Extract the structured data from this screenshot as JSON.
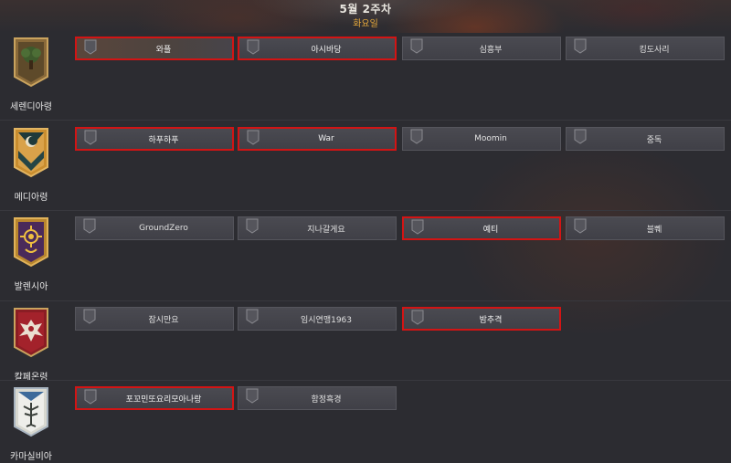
{
  "header": {
    "title": "5월 2주차",
    "subtitle": "화요일"
  },
  "colors": {
    "selected_border": "#d31414",
    "subtitle": "#e6a93b",
    "slot_bg": "#45454c",
    "page_bg": "#2c2c31"
  },
  "territories": [
    {
      "name": "세렌디아령",
      "crest_icon": "tree-crest-icon",
      "guilds": [
        {
          "label": "와플",
          "selected": true
        },
        {
          "label": "아시바당",
          "selected": true
        },
        {
          "label": "심흥부",
          "selected": false
        },
        {
          "label": "킹도사리",
          "selected": false
        }
      ]
    },
    {
      "name": "메디아령",
      "crest_icon": "crescent-crest-icon",
      "guilds": [
        {
          "label": "하푸하푸",
          "selected": true
        },
        {
          "label": "War",
          "selected": true
        },
        {
          "label": "Moomin",
          "selected": false
        },
        {
          "label": "중독",
          "selected": false
        }
      ]
    },
    {
      "name": "발렌시아",
      "crest_icon": "sun-crest-icon",
      "guilds": [
        {
          "label": "GroundZero",
          "selected": false
        },
        {
          "label": "지나갈게요",
          "selected": false
        },
        {
          "label": "예티",
          "selected": true
        },
        {
          "label": "블쀄",
          "selected": false
        }
      ]
    },
    {
      "name": "칼페온령",
      "crest_icon": "eagle-crest-icon",
      "guilds": [
        {
          "label": "잠시만요",
          "selected": false
        },
        {
          "label": "임시연맹1963",
          "selected": false
        },
        {
          "label": "밤추격",
          "selected": true
        }
      ]
    },
    {
      "name": "카마실비아",
      "crest_icon": "tree-of-life-crest-icon",
      "guilds": [
        {
          "label": "포꼬민또요리모아나랑",
          "selected": true
        },
        {
          "label": "함정흑경",
          "selected": false
        }
      ]
    }
  ]
}
